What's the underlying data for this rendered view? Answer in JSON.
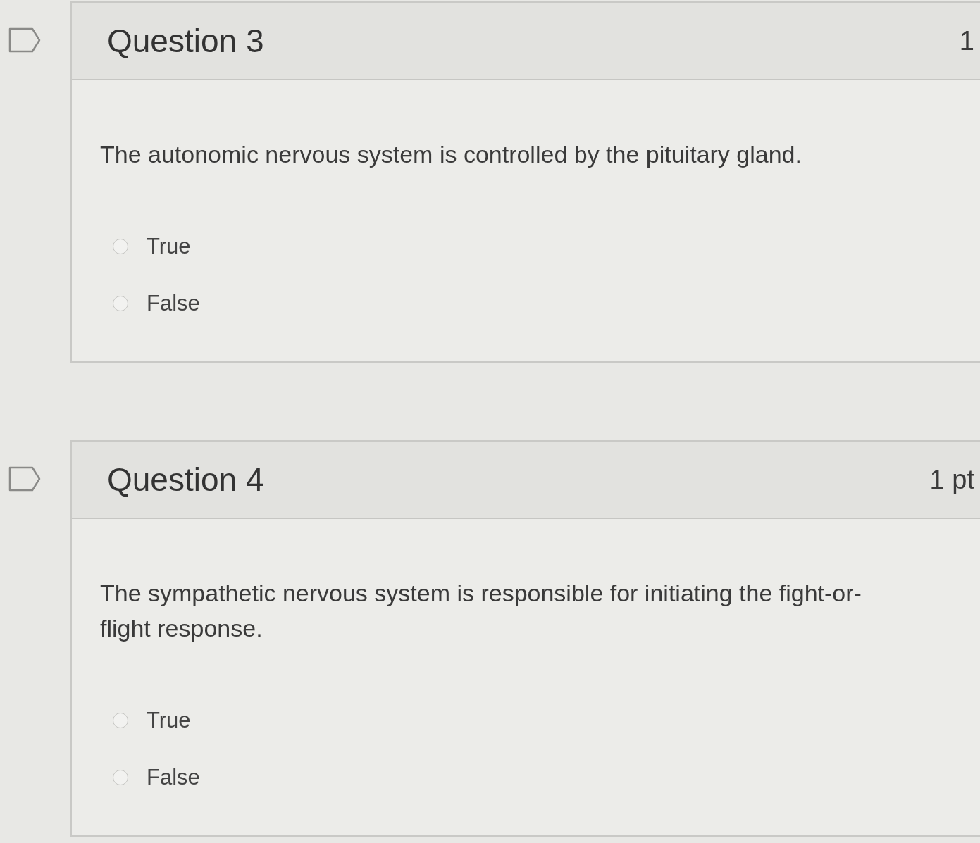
{
  "questions": [
    {
      "title": "Question 3",
      "points": "1",
      "flagged": false,
      "text": "The autonomic nervous system is controlled by the pituitary gland.",
      "answers": [
        {
          "label": "True",
          "selected": false
        },
        {
          "label": "False",
          "selected": false
        }
      ]
    },
    {
      "title": "Question 4",
      "points": "1 pt",
      "flagged": false,
      "text": "The sympathetic nervous system is responsible for initiating the fight-or-flight response.",
      "answers": [
        {
          "label": "True",
          "selected": false
        },
        {
          "label": "False",
          "selected": false
        }
      ]
    }
  ]
}
